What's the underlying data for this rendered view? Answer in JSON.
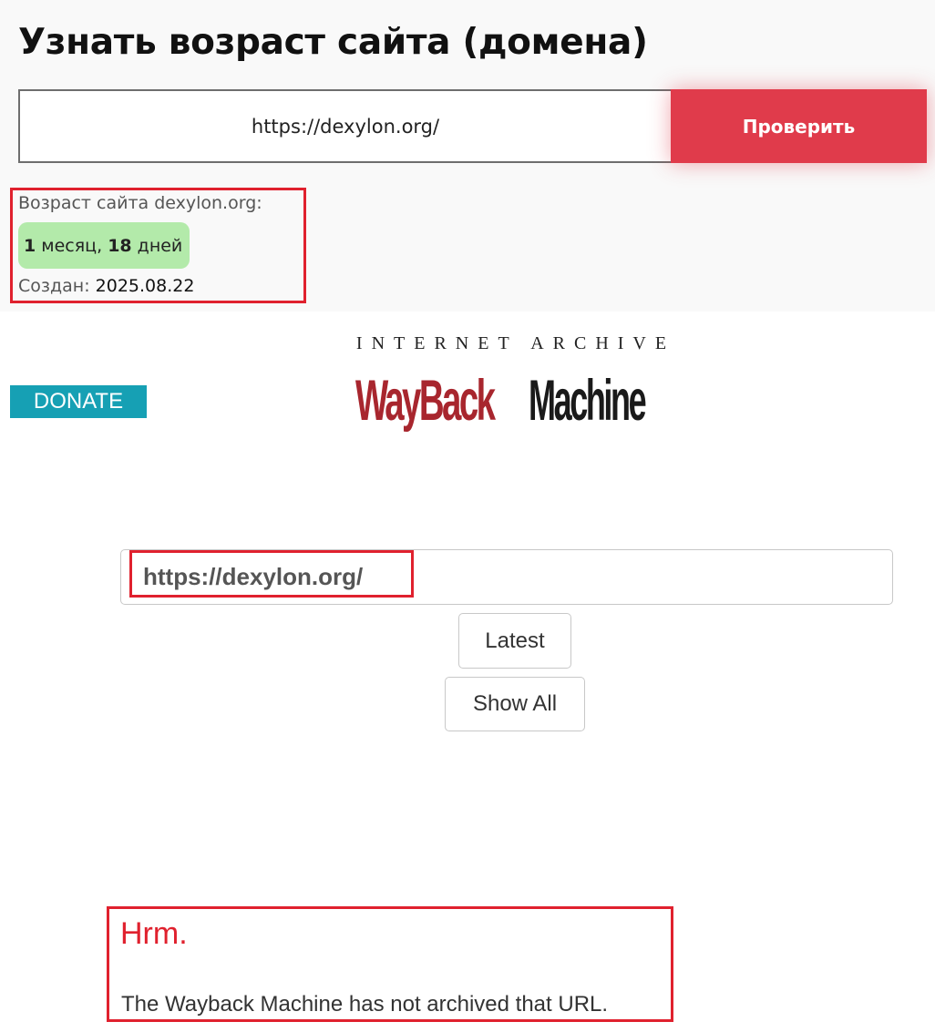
{
  "checker": {
    "title": "Узнать возраст сайта (домена)",
    "url_value": "https://dexylon.org/",
    "check_label": "Проверить",
    "age_label": "Возраст сайта dexylon.org:",
    "age": {
      "months_num": "1",
      "months_word": " месяц, ",
      "days_num": "18",
      "days_word": " дней"
    },
    "created_label": "Создан: ",
    "created_value": "2025.08.22",
    "accent_color": "#e03b4b",
    "badge_color": "#b3eaaa"
  },
  "wayback": {
    "donate_label": "DONATE",
    "logo_top_text": "INTERNET ARCHIVE",
    "logo_way": "WayBack",
    "logo_machine": "Machine",
    "url_value": "https://dexylon.org/",
    "latest_label": "Latest",
    "show_all_label": "Show All",
    "error_title": "Hrm.",
    "error_message": "The Wayback Machine has not archived that URL.",
    "logo_red": "#a8262e",
    "donate_color": "#16a0b4"
  },
  "highlight_color": "#e0212e"
}
